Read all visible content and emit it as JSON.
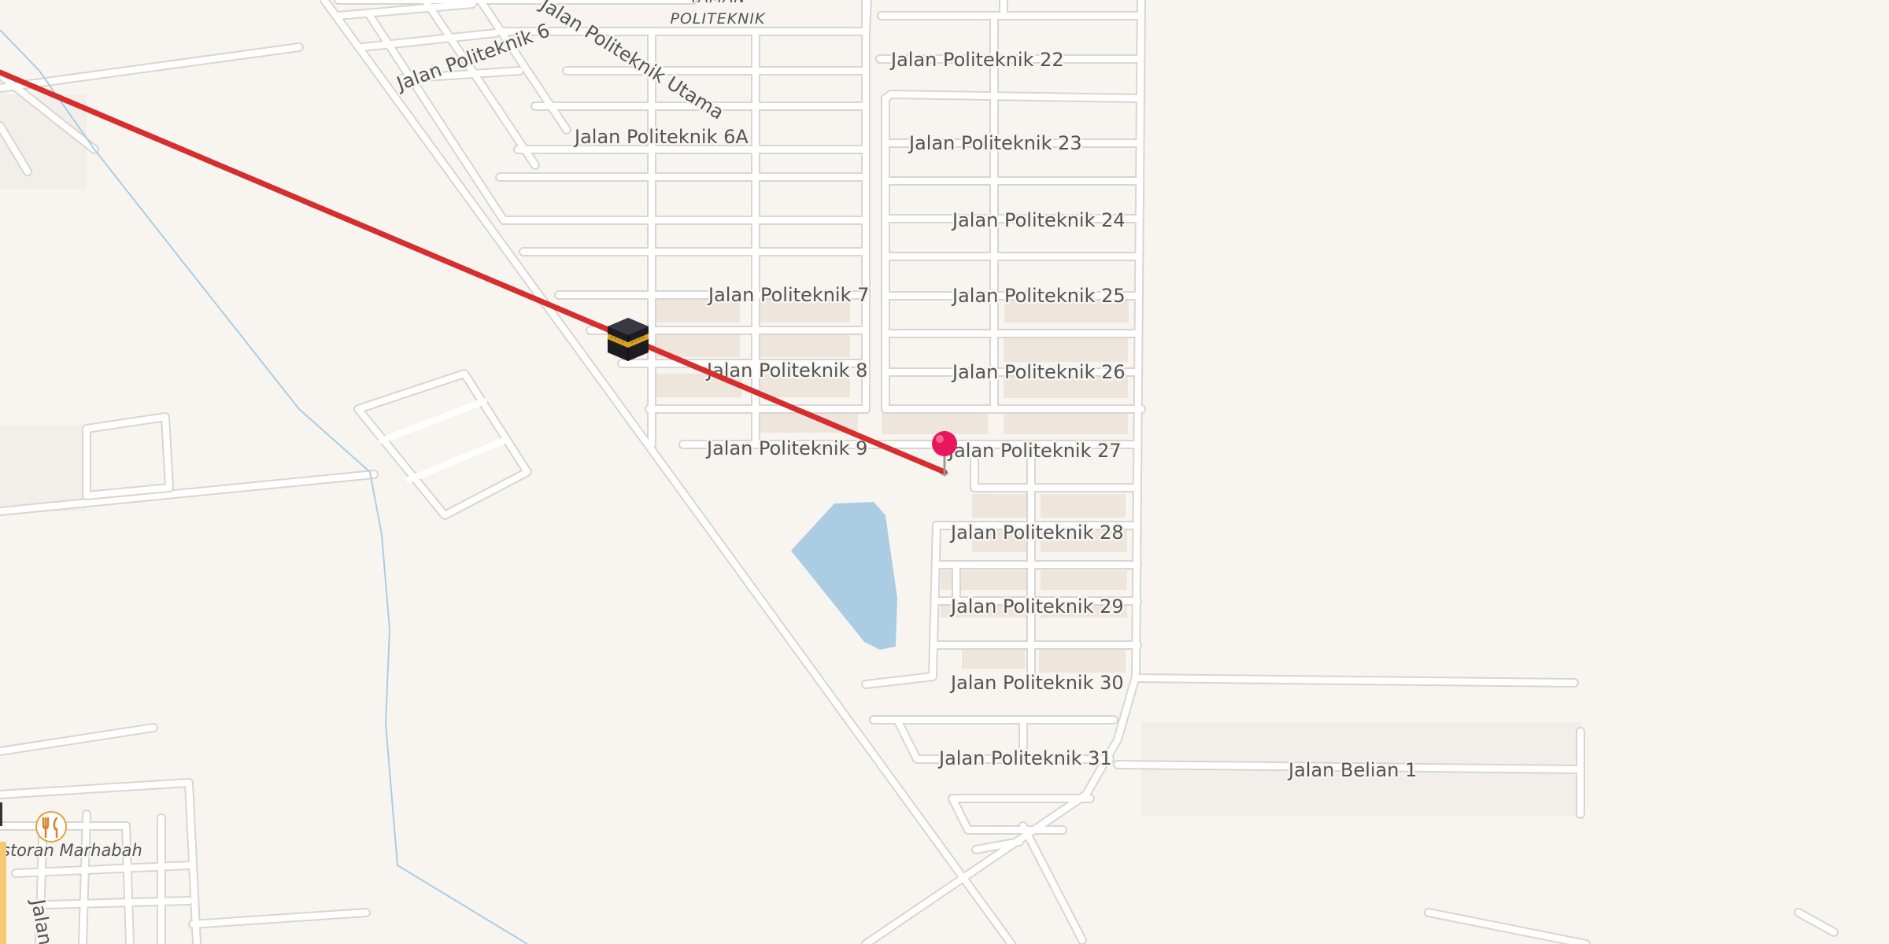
{
  "map": {
    "area_label": {
      "line1": "TAMAN",
      "line2": "POLITEKNIK"
    },
    "streets": [
      "Jalan Politeknik 6",
      "Jalan Politeknik Utama",
      "Jalan Politeknik 22",
      "Jalan Politeknik 6A",
      "Jalan Politeknik 23",
      "Jalan Politeknik 24",
      "Jalan Politeknik 7",
      "Jalan Politeknik 25",
      "Jalan Politeknik 8",
      "Jalan Politeknik 26",
      "Jalan Politeknik 9",
      "Jalan Politeknik 27",
      "Jalan Politeknik 28",
      "Jalan Politeknik 29",
      "Jalan Politeknik 30",
      "Jalan Politeknik 31",
      "Jalan Belian 1",
      "Jalan"
    ],
    "poi": {
      "restaurant_label": "storan Marhabah",
      "restaurant_icon": "fork-knife-icon"
    },
    "markers": {
      "kaaba_icon": "kaaba-icon",
      "pin_icon": "map-pin-icon"
    },
    "colors": {
      "land": "#f8f5f1",
      "road": "#ffffff",
      "road_casing": "#d9d5d0",
      "water": "#abcde3",
      "building": "#eee5dd",
      "qibla_line": "#d62d2d",
      "pin": "#e8175d"
    }
  }
}
